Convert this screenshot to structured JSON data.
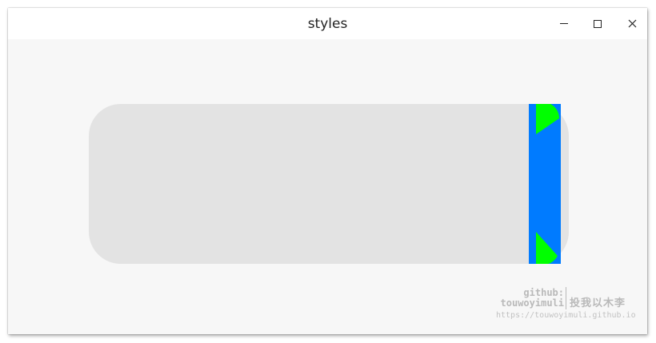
{
  "window": {
    "title": "styles"
  },
  "titlebar_buttons": {
    "minimize": "minimize-icon",
    "maximize": "maximize-icon",
    "close": "close-icon"
  },
  "colors": {
    "track": "#e3e3e3",
    "handle": "#007bff",
    "handle_markers": "#00ff00",
    "background": "#f7f7f7"
  },
  "watermark": {
    "github_label": "github:",
    "github_user": "touwoyimuli",
    "signature": "投我以木李",
    "url": "https://touwoyimuli.github.io"
  }
}
